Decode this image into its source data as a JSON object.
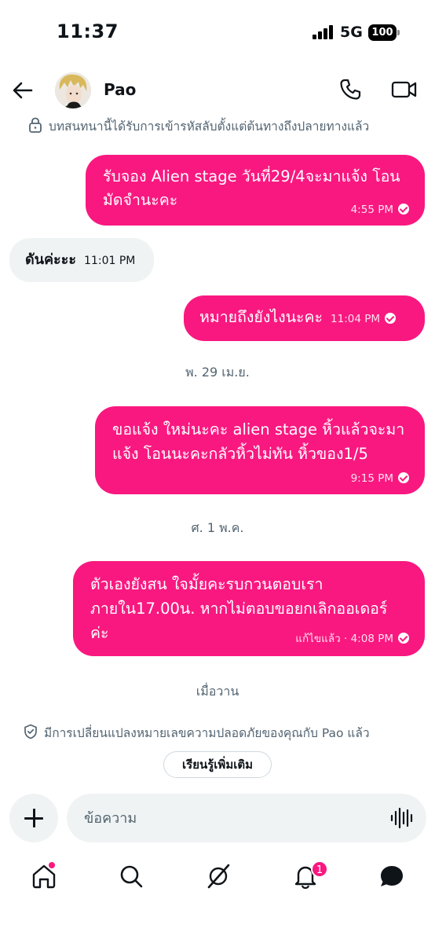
{
  "status_bar": {
    "time": "11:37",
    "network": "5G",
    "battery": "100"
  },
  "header": {
    "contact_name": "Pao",
    "icons": [
      "back-arrow-icon",
      "phone-icon",
      "video-icon"
    ]
  },
  "encryption_notice": "บทสนทนานี้ได้รับการเข้ารหัสลับตั้งแต่ต้นทางถึงปลายทางแล้ว",
  "messages": [
    {
      "direction": "out",
      "text_line1": "รับจอง Alien stage วันที่29/4จะมาแจ้ง โอน",
      "text_line2": "มัดจำนะคะ",
      "time": "4:55 PM"
    },
    {
      "direction": "in",
      "text": "ดันค่ะะะ",
      "time": "11:01 PM"
    },
    {
      "direction": "out",
      "text": "หมายถึงยังไงนะคะ",
      "time": "11:04 PM"
    },
    {
      "direction": "out",
      "text_line1": "ขอแจ้ง ใหม่นะคะ alien stage หิ้วแล้วจะมา",
      "text_line2": "แจ้ง โอนนะคะกลัวหิ้วไม่ทัน หิ้วของ1/5",
      "time": "9:15 PM"
    },
    {
      "direction": "out",
      "text_line1": "ตัวเองยังสน ใจมั้ยคะรบกวนตอบเรา",
      "text_line2": "ภายใน17.00น. หากไม่ตอบขอยกเลิกออเดอร์",
      "text_line3": "ค่ะ",
      "edited": "แก้ไขแล้ว",
      "time": "4:08 PM"
    }
  ],
  "date_separators": {
    "apr29": "พ. 29 เม.ย.",
    "may1": "ศ. 1 พ.ค.",
    "yesterday": "เมื่อวาน"
  },
  "safety_notice": "มีการเปลี่ยนแปลงหมายเลขความปลอดภัยของคุณกับ Pao แล้ว",
  "learn_more_label": "เรียนรู้เพิ่มเติม",
  "composer": {
    "placeholder": "ข้อความ"
  },
  "bottom_nav": {
    "items": [
      "home-icon",
      "search-icon",
      "grok-icon",
      "notifications-icon",
      "messages-icon"
    ],
    "notification_count": "1"
  },
  "colors": {
    "accent": "#f91880",
    "incoming_bubble": "#eff3f4",
    "secondary_text": "#536471"
  }
}
